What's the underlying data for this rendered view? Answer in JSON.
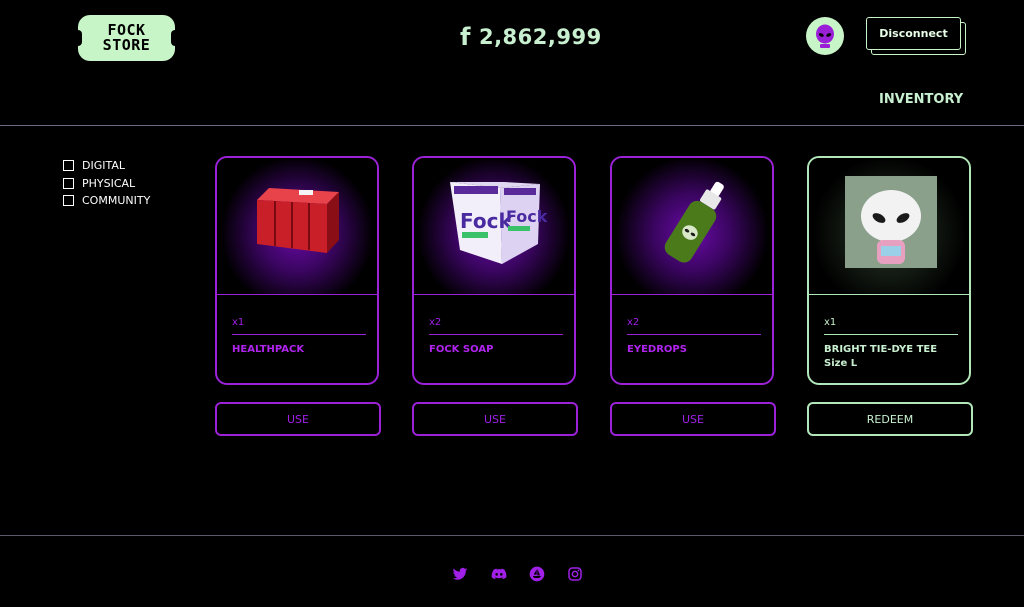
{
  "header": {
    "logo_line1": "FOCK",
    "logo_line2": "STORE",
    "balance_currency": "f",
    "balance": "2,862,999",
    "disconnect_label": "Disconnect"
  },
  "page_title": "INVENTORY",
  "filters": [
    {
      "label": "DIGITAL",
      "checked": false
    },
    {
      "label": "PHYSICAL",
      "checked": false
    },
    {
      "label": "COMMUNITY",
      "checked": false
    }
  ],
  "items": [
    {
      "quantity": "x1",
      "name": "HEALTHPACK",
      "size": "",
      "action": "USE",
      "theme": "purple"
    },
    {
      "quantity": "x2",
      "name": "FOCK SOAP",
      "size": "",
      "action": "USE",
      "theme": "purple"
    },
    {
      "quantity": "x2",
      "name": "EYEDROPS",
      "size": "",
      "action": "USE",
      "theme": "purple"
    },
    {
      "quantity": "x1",
      "name": "BRIGHT TIE-DYE TEE",
      "size": "Size L",
      "action": "REDEEM",
      "theme": "green"
    }
  ],
  "social_icons": [
    "twitter-icon",
    "discord-icon",
    "opensea-icon",
    "instagram-icon"
  ],
  "colors": {
    "purple_accent": "#9b22d8",
    "green_accent": "#b0e6b8",
    "background": "#000000"
  }
}
